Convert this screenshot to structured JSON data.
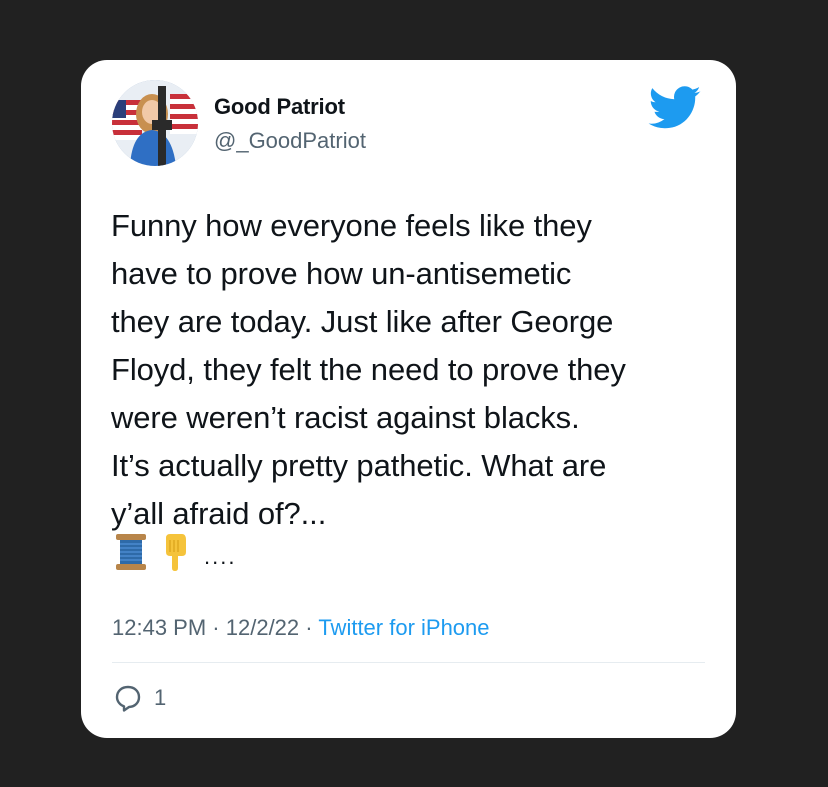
{
  "tweet": {
    "display_name": "Good Patriot",
    "handle": "@_GoodPatriot",
    "text": "Funny how everyone feels like they\nhave to prove how un-antisemetic\nthey are today. Just like after George\nFloyd, they felt the need to prove they\nwere weren’t racist against blacks.\nIt’s actually pretty pathetic. What are\ny’all afraid of?...",
    "emoji_icons": [
      "spool-of-thread-icon",
      "pointing-down-icon"
    ],
    "trailing_dots": "....",
    "time": "12:43 PM",
    "separator": "·",
    "date": "12/2/22",
    "source": "Twitter for iPhone",
    "reply_count": "1"
  },
  "colors": {
    "background": "#212121",
    "card": "#ffffff",
    "text_primary": "#0f1419",
    "text_secondary": "#536471",
    "twitter_blue": "#1d9bf0"
  }
}
